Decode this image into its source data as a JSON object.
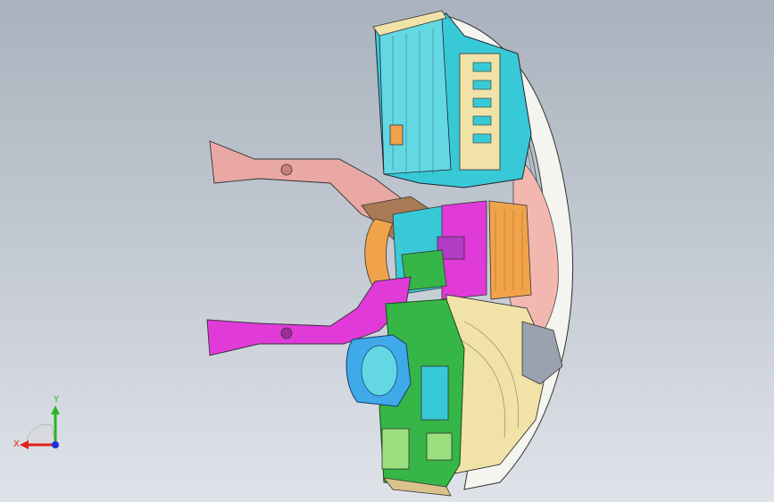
{
  "viewport": {
    "background_top": "#a9b2bd",
    "background_bottom": "#dfe3e9"
  },
  "model": {
    "colors": {
      "duct_pink": "#e9a8a4",
      "duct_magenta": "#e03ad8",
      "hvac_cyan": "#38c9d6",
      "hvac_cyan_light": "#63d8e3",
      "orange": "#f0a34a",
      "beige": "#f1e3a8",
      "green": "#36b646",
      "light_green": "#9be07e",
      "blue_blower": "#3fa9ea",
      "brown": "#a97a55",
      "purple": "#b23cc6",
      "salmon": "#f2b8b0",
      "white_frame": "#f5f5f0",
      "gray_part": "#9aa3ad"
    }
  },
  "triad": {
    "x_label": "X",
    "y_label": "Y",
    "x_color": "#e0201c",
    "y_color": "#26b626",
    "z_color": "#1c2ee0"
  }
}
